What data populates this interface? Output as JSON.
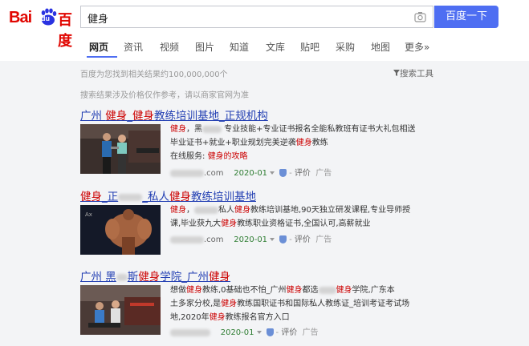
{
  "header": {
    "logo_bai": "Bai",
    "logo_du": "du",
    "logo_cn": "百度",
    "query": "健身",
    "search_button": "百度一下"
  },
  "tabs": [
    {
      "label": "网页",
      "active": true
    },
    {
      "label": "资讯"
    },
    {
      "label": "视频"
    },
    {
      "label": "图片"
    },
    {
      "label": "知道"
    },
    {
      "label": "文库"
    },
    {
      "label": "贴吧"
    },
    {
      "label": "采购"
    },
    {
      "label": "地图"
    },
    {
      "label": "更多»"
    }
  ],
  "stats": "百度为您找到相关结果约100,000,000个",
  "tools": "搜索工具",
  "notice": "搜索结果涉及价格仅作参考，请以商家官网为准",
  "results": [
    {
      "title_a": "广州 ",
      "title_b": "健身",
      "title_c": "_",
      "title_d": "健身",
      "title_e": "教练培训基地_正规机构",
      "desc_l1_a": "健身",
      "desc_l1_b": "，黑",
      "desc_l1_c": " 专业技能+专业证书报名全能私教班有证书大礼包相送",
      "desc_l2_a": "毕业证书+就业+职业规划完美逆袭",
      "desc_l2_b": "健身",
      "desc_l2_c": "教练",
      "desc_l3_a": "在线服务: ",
      "desc_l3_b": "健身的攻略",
      "url_end": ".com",
      "date": "2020-01",
      "rate": "评价",
      "ad": "广告"
    },
    {
      "title_a": "健身",
      "title_b": "_正",
      "title_c": "_私人",
      "title_d": "健身",
      "title_e": "教练培训基地",
      "desc_l1_a": "健身",
      "desc_l1_b": "，",
      "desc_l1_c": "私人",
      "desc_l1_d": "健身",
      "desc_l1_e": "教练培训基地,90天独立研发课程,专业导师授",
      "desc_l2_a": "课,毕业获九大",
      "desc_l2_b": "健身",
      "desc_l2_c": "教练职业资格证书,全国认可,高薪就业",
      "url_end": ".com",
      "date": "2020-01",
      "rate": "评价",
      "ad": "广告"
    },
    {
      "title_a": "广州 黑",
      "title_b": "斯",
      "title_c": "健身",
      "title_d": "学院_广州",
      "title_e": "健身",
      "desc_l1_a": "想做",
      "desc_l1_b": "健身",
      "desc_l1_c": "教练,0基础也不怕_广州",
      "desc_l1_d": "健身",
      "desc_l1_e": "都选",
      "desc_l1_f": "健身",
      "desc_l1_g": "学院,广东本",
      "desc_l2_a": "土多家分校,是",
      "desc_l2_b": "健身",
      "desc_l2_c": "教练国职证书和国际私人教练证_培训考证考试场",
      "desc_l3_a": "地,2020年",
      "desc_l3_b": "健身",
      "desc_l3_c": "教练报名官方入口",
      "url_end": "",
      "date": "2020-01",
      "rate": "评价",
      "ad": "广告"
    }
  ]
}
